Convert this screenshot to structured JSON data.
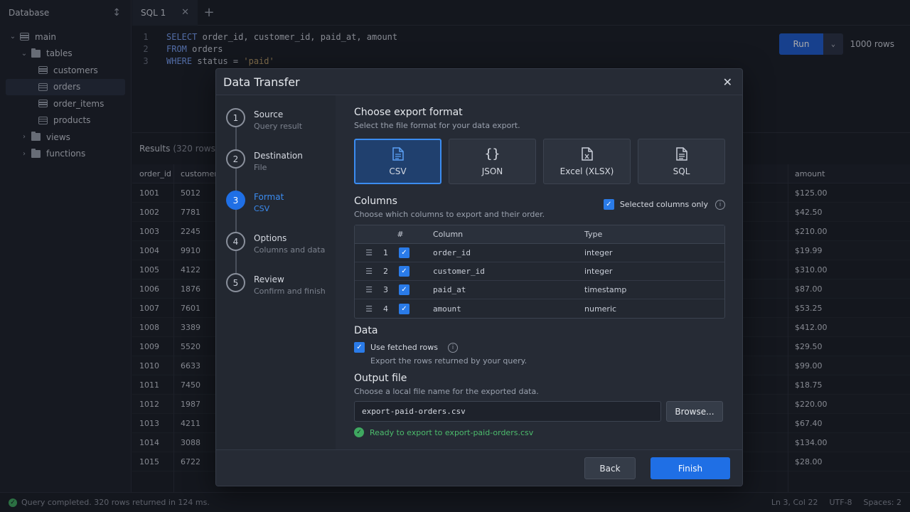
{
  "sidebar": {
    "title": "Database",
    "tree": [
      {
        "label": "main",
        "kind": "db",
        "expanded": true
      },
      {
        "label": "tables",
        "kind": "folder",
        "expanded": true
      },
      {
        "label": "customers",
        "kind": "table"
      },
      {
        "label": "orders",
        "kind": "table",
        "active": true
      },
      {
        "label": "order_items",
        "kind": "table"
      },
      {
        "label": "products",
        "kind": "table"
      },
      {
        "label": "views",
        "kind": "folder"
      },
      {
        "label": "functions",
        "kind": "folder"
      }
    ]
  },
  "tabs": [
    {
      "label": "SQL 1"
    }
  ],
  "editor": {
    "lines": [
      {
        "num": "1",
        "kw": "SELECT",
        "rest": " order_id, customer_id, paid_at, amount",
        "str": ""
      },
      {
        "num": "2",
        "kw": "FROM",
        "rest": " orders",
        "str": ""
      },
      {
        "num": "3",
        "kw": "WHERE",
        "rest": " status = ",
        "str": "'paid'"
      }
    ],
    "run_label": "Run",
    "rows_limit": "1000 rows"
  },
  "results": {
    "title": "Results",
    "count": "(320 rows)",
    "columns": [
      "order_id",
      "customer_",
      "amount"
    ],
    "rows": [
      {
        "order_id": "1001",
        "customer_id": "5012",
        "amount": "$125.00"
      },
      {
        "order_id": "1002",
        "customer_id": "7781",
        "amount": "$42.50"
      },
      {
        "order_id": "1003",
        "customer_id": "2245",
        "amount": "$210.00"
      },
      {
        "order_id": "1004",
        "customer_id": "9910",
        "amount": "$19.99"
      },
      {
        "order_id": "1005",
        "customer_id": "4122",
        "amount": "$310.00"
      },
      {
        "order_id": "1006",
        "customer_id": "1876",
        "amount": "$87.00"
      },
      {
        "order_id": "1007",
        "customer_id": "7601",
        "amount": "$53.25"
      },
      {
        "order_id": "1008",
        "customer_id": "3389",
        "amount": "$412.00"
      },
      {
        "order_id": "1009",
        "customer_id": "5520",
        "amount": "$29.50"
      },
      {
        "order_id": "1010",
        "customer_id": "6633",
        "amount": "$99.00"
      },
      {
        "order_id": "1011",
        "customer_id": "7450",
        "amount": "$18.75"
      },
      {
        "order_id": "1012",
        "customer_id": "1987",
        "amount": "$220.00"
      },
      {
        "order_id": "1013",
        "customer_id": "4211",
        "amount": "$67.40"
      },
      {
        "order_id": "1014",
        "customer_id": "3088",
        "amount": "$134.00"
      },
      {
        "order_id": "1015",
        "customer_id": "6722",
        "amount": "$28.00"
      }
    ]
  },
  "status": {
    "message": "Query completed. 320 rows returned in 124 ms.",
    "position": "Ln 3, Col 22",
    "encoding": "UTF-8",
    "indent": "Spaces: 2"
  },
  "dialog": {
    "title": "Data Transfer",
    "steps": [
      {
        "num": "1",
        "title": "Source",
        "sub": "Query result"
      },
      {
        "num": "2",
        "title": "Destination",
        "sub": "File"
      },
      {
        "num": "3",
        "title": "Format",
        "sub": "CSV",
        "active": true
      },
      {
        "num": "4",
        "title": "Options",
        "sub": "Columns and data"
      },
      {
        "num": "5",
        "title": "Review",
        "sub": "Confirm and finish"
      }
    ],
    "format_section": {
      "title": "Choose export format",
      "subtitle": "Select the file format for your data export.",
      "options": [
        {
          "label": "CSV",
          "icon": "csv-file-icon",
          "selected": true
        },
        {
          "label": "JSON",
          "icon": "braces-icon"
        },
        {
          "label": "Excel (XLSX)",
          "icon": "excel-file-icon"
        },
        {
          "label": "SQL",
          "icon": "sql-file-icon"
        }
      ]
    },
    "columns_section": {
      "title": "Columns",
      "subtitle": "Choose which columns to export and their order.",
      "selected_only_label": "Selected columns only",
      "headers": {
        "num": "#",
        "column": "Column",
        "type": "Type"
      },
      "rows": [
        {
          "num": "1",
          "name": "order_id",
          "type": "integer"
        },
        {
          "num": "2",
          "name": "customer_id",
          "type": "integer"
        },
        {
          "num": "3",
          "name": "paid_at",
          "type": "timestamp"
        },
        {
          "num": "4",
          "name": "amount",
          "type": "numeric"
        }
      ]
    },
    "data_section": {
      "title": "Data",
      "use_fetched_label": "Use fetched rows",
      "use_fetched_help": "Export the rows returned by your query."
    },
    "output_section": {
      "title": "Output file",
      "subtitle": "Choose a local file name for the exported data.",
      "filename": "export-paid-orders.csv",
      "browse_label": "Browse...",
      "ready_message": "Ready to export to export-paid-orders.csv"
    },
    "back_label": "Back",
    "finish_label": "Finish"
  }
}
